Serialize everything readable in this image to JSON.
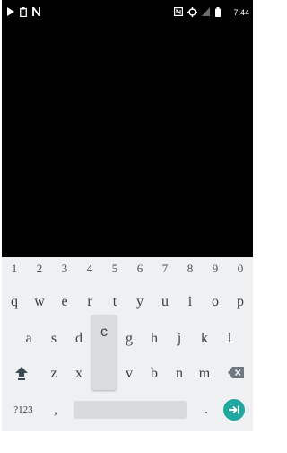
{
  "status_bar": {
    "left_icons": [
      "play-icon",
      "clipboard-icon",
      "notification-n-icon"
    ],
    "right_icons": [
      "nfc-icon",
      "data-sync-icon",
      "signal-icon",
      "battery-icon"
    ],
    "time": "7:44"
  },
  "keyboard": {
    "number_row": [
      "1",
      "2",
      "3",
      "4",
      "5",
      "6",
      "7",
      "8",
      "9",
      "0"
    ],
    "row1": [
      "q",
      "w",
      "e",
      "r",
      "t",
      "y",
      "u",
      "i",
      "o",
      "p"
    ],
    "row2": [
      "a",
      "s",
      "d",
      "f",
      "g",
      "h",
      "j",
      "k",
      "l"
    ],
    "row3": [
      "z",
      "x",
      "c",
      "v",
      "b",
      "n",
      "m"
    ],
    "pressed_key": "c",
    "symbols_label": "?123",
    "comma_label": ",",
    "period_label": ".",
    "shift_icon": "shift-up-arrow-icon",
    "backspace_icon": "backspace-icon",
    "enter_icon": "enter-arrow-icon",
    "accent_color": "#1fa7a0"
  }
}
